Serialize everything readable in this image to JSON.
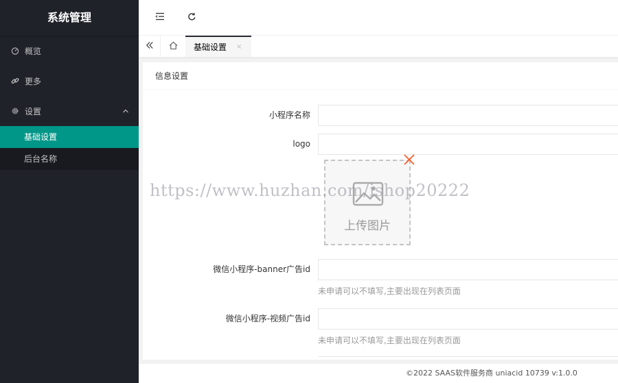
{
  "app": {
    "title": "系统管理"
  },
  "sidebar": {
    "items": [
      {
        "label": "概览",
        "icon": "dashboard-icon"
      },
      {
        "label": "更多",
        "icon": "link-icon"
      },
      {
        "label": "设置",
        "icon": "gear-icon",
        "expanded": true,
        "children": [
          {
            "label": "基础设置",
            "active": true
          },
          {
            "label": "后台名称",
            "active": false
          }
        ]
      }
    ]
  },
  "header": {
    "buttons": [
      "menu-fold-icon",
      "refresh-icon"
    ]
  },
  "tabs": {
    "items": [
      {
        "label": "基础设置",
        "close": "×"
      }
    ]
  },
  "card": {
    "title": "信息设置"
  },
  "form": {
    "fields": [
      {
        "label": "小程序名称",
        "value": ""
      },
      {
        "label": "logo",
        "value": ""
      },
      {
        "label": "微信小程序-banner广告id",
        "value": "",
        "hint": "未申请可以不填写,主要出现在列表页面"
      },
      {
        "label": "微信小程序-视频广告id",
        "value": "",
        "hint": "未申请可以不填写,主要出现在列表页面"
      }
    ],
    "upload": {
      "label": "上传图片"
    }
  },
  "watermark": "https://www.huzhan.com/ishop20222",
  "footer": {
    "text": "©2022 SAAS软件服务商 uniacid 10739  v:1.0.0"
  },
  "colors": {
    "sidebar": "#20222a",
    "active": "#009688",
    "close": "#ff5722"
  }
}
